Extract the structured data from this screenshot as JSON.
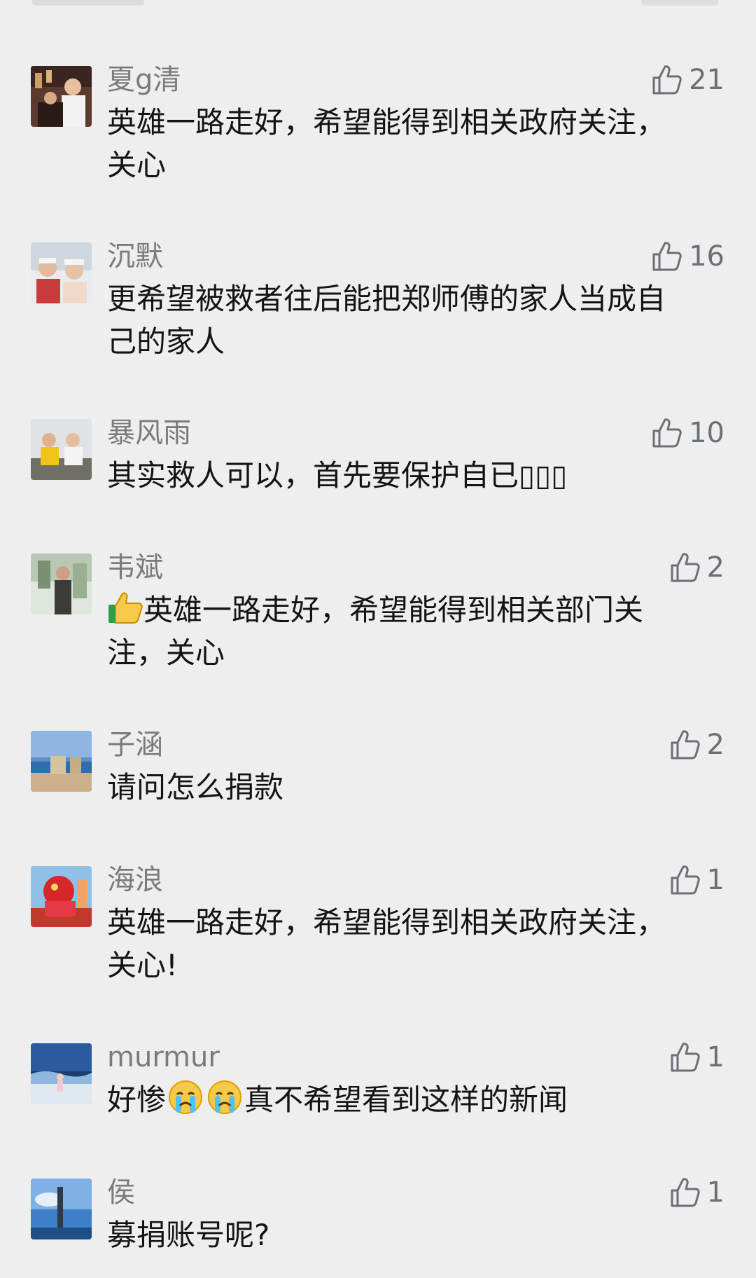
{
  "comments": [
    {
      "name": "夏g清",
      "likes": "21",
      "text": "英雄一路走好，希望能得到相关政府关注，\n关心"
    },
    {
      "name": "沉默",
      "likes": "16",
      "text": "更希望被救者往后能把郑师傅的家人当成自\n己的家人"
    },
    {
      "name": "暴风雨",
      "likes": "10",
      "text": "其实救人可以，首先要保护自已▯▯▯"
    },
    {
      "name": "韦斌",
      "likes": "2",
      "text_after_emoji": "英雄一路走好，希望能得到相关部门关\n注，关心",
      "emoji": "thumbs-up-emoji"
    },
    {
      "name": "子涵",
      "likes": "2",
      "text": "请问怎么捐款"
    },
    {
      "name": "海浪",
      "likes": "1",
      "text": "英雄一路走好，希望能得到相关政府关注，\n关心!"
    },
    {
      "name": "murmur",
      "likes": "1",
      "text_before": "好惨",
      "text_after": "真不希望看到这样的新闻",
      "emoji": "crying-face-emoji"
    },
    {
      "name": "侯",
      "likes": "1",
      "text": "募捐账号呢?"
    }
  ],
  "icons": {
    "like": "thumbs-up-outline-icon"
  },
  "colors": {
    "background": "#eeeeee",
    "name": "#7b7b7b",
    "text": "#141414",
    "like": "#6b6f78"
  }
}
